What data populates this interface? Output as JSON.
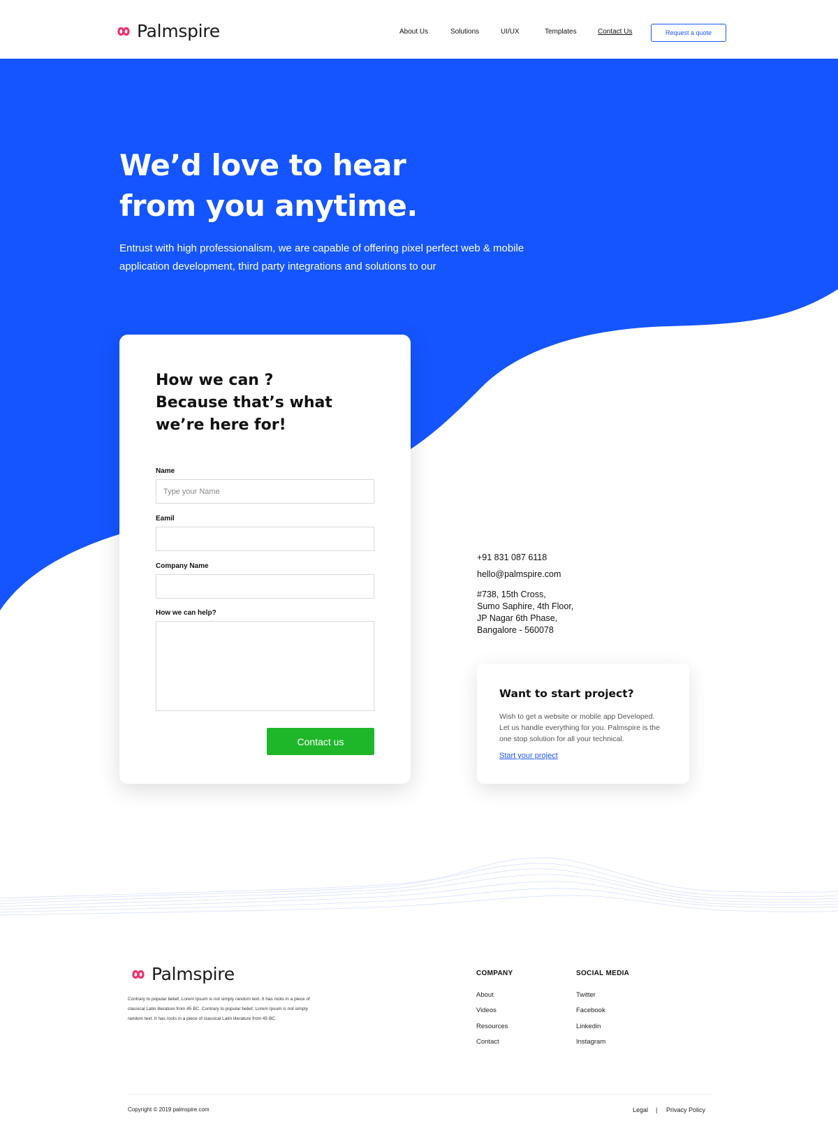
{
  "brand": {
    "name": "Palmspire",
    "accent": "#1a56ff",
    "logo_color": "#f0306c",
    "cta_color": "#1fb72a"
  },
  "nav": {
    "items": [
      {
        "label": "About Us"
      },
      {
        "label": "Solutions"
      },
      {
        "label": "UI/UX"
      },
      {
        "label": "Templates"
      },
      {
        "label": "Contact Us"
      }
    ],
    "active": "Contact Us",
    "quote_button": "Request a quote"
  },
  "hero": {
    "title_line1": "We’d love to hear",
    "title_line2": "from you anytime.",
    "subtitle_line1": "Entrust with high professionalism, we are capable of offering pixel perfect web & mobile",
    "subtitle_line2": "application development, third party integrations and solutions to our"
  },
  "form": {
    "title_line1": "How we can ?",
    "title_line2": "Because that’s what",
    "title_line3": "we’re here for!",
    "name_label": "Name",
    "name_placeholder": "Type your Name",
    "email_label": "Eamil",
    "company_label": "Company Name",
    "help_label": "How we can help?",
    "submit_label": "Contact us"
  },
  "contact": {
    "phone": "+91 831 087 6118",
    "email": "hello@palmspire.com",
    "address": [
      "#738, 15th Cross,",
      "Sumo Saphire, 4th Floor,",
      "JP Nagar 6th Phase,",
      "Bangalore - 560078"
    ]
  },
  "project": {
    "title": "Want to start project?",
    "text_line1": "Wish to get a website or mobile app Developed.",
    "text_line2": "Let us handle everything for you. Palmspire is the",
    "text_line3": "one stop solution for all your technical.",
    "link": "Start your project"
  },
  "footer": {
    "desc_line1": "Contrary to popular belief, Lorem Ipsum is not simply random text. It has roots in a piece of",
    "desc_line2": "classical Latin literature from 45 BC. Contrary to popular belief, Lorem Ipsum is not simply",
    "desc_line3": "random text. It has roots in a piece of classical Latin literature from 45 BC.",
    "company_heading": "COMPANY",
    "company_links": [
      "About",
      "Videos",
      "Resources",
      "Contact"
    ],
    "social_heading": "SOCIAL MEDIA",
    "social_links": [
      "Twitter",
      "Facebook",
      "Linkedin",
      "Instagram"
    ],
    "copyright": "Copyright © 2019  palmspire.com",
    "legal": "Legal",
    "separator": "|",
    "privacy": "Privacy Policy"
  }
}
